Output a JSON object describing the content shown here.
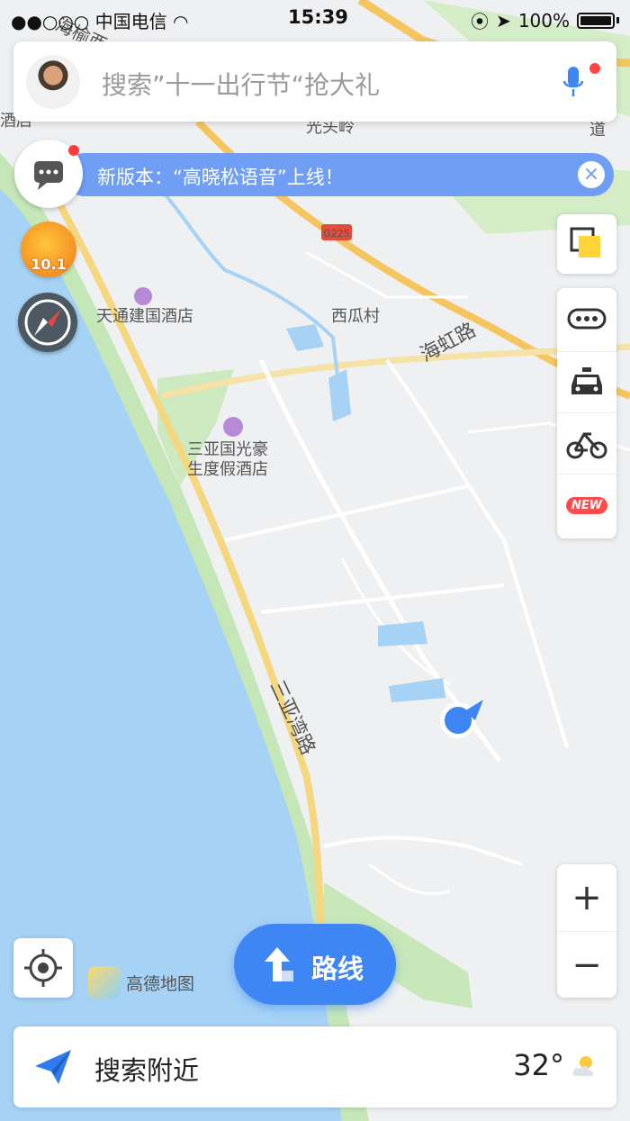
{
  "status_bar": {
    "carrier": "●●○○○ 中国电信",
    "time": "15:39",
    "battery": "100%"
  },
  "search": {
    "placeholder": "搜索”十一出行节“抢大礼"
  },
  "banner": {
    "text": "新版本：“高晓松语音”上线！",
    "close": "×"
  },
  "promo": {
    "label": "10.1"
  },
  "map": {
    "labels": {
      "street_top_left": "海榆西",
      "hotel_edge": "酒店",
      "ridge": "光头岭",
      "highway": "G225",
      "village": "西瓜村",
      "road_haihong": "海虹路",
      "hotel1": "天通建国酒店",
      "hotel2_line1": "三亚国光豪",
      "hotel2_line2": "生度假酒店",
      "road_sanyawan": "三亚湾路",
      "edge_right": "道"
    }
  },
  "side_tools": {
    "new_badge": "NEW"
  },
  "zoom": {
    "in": "+",
    "out": "−"
  },
  "logo": {
    "text": "高德地图"
  },
  "route_button": {
    "label": "路线"
  },
  "bottom_bar": {
    "label": "搜索附近",
    "temperature": "32°"
  }
}
